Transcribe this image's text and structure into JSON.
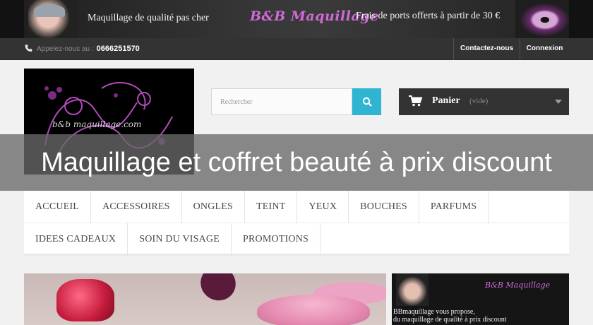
{
  "promo_banner": {
    "tagline": "Maquillage de qualité pas cher",
    "brand_logo": "B&B Maquillage",
    "shipping": "Frais de ports offerts à partir de 30 €"
  },
  "utility_bar": {
    "phone_label": "Appelez-nous au :",
    "phone_number": "0666251570",
    "contact": "Contactez-nous",
    "login": "Connexion"
  },
  "header": {
    "logo_text": "b&b maquillage.com",
    "search_placeholder": "Rechercher",
    "cart_label": "Panier",
    "cart_status": "(vide)"
  },
  "overlay_title": "Maquillage et coffret beauté à prix discount",
  "menu": {
    "row1": [
      "ACCUEIL",
      "ACCESSOIRES",
      "ONGLES",
      "TEINT",
      "YEUX",
      "BOUCHES",
      "PARFUMS"
    ],
    "row2": [
      "IDEES CADEAUX",
      "SOIN DU VISAGE",
      "PROMOTIONS"
    ]
  },
  "side_banner": {
    "logo": "B&B Maquillage",
    "line1": "BBmaquillage vous propose,",
    "line2": "du maquillage de qualité à prix discount"
  },
  "icons": {
    "phone": "phone-icon",
    "search": "search-icon",
    "cart": "cart-icon",
    "cart_dropdown": "chevron-down-icon"
  },
  "colors": {
    "accent": "#2fb5d2",
    "dark_bar": "#333333",
    "brand_purple": "#cf6ad6"
  }
}
